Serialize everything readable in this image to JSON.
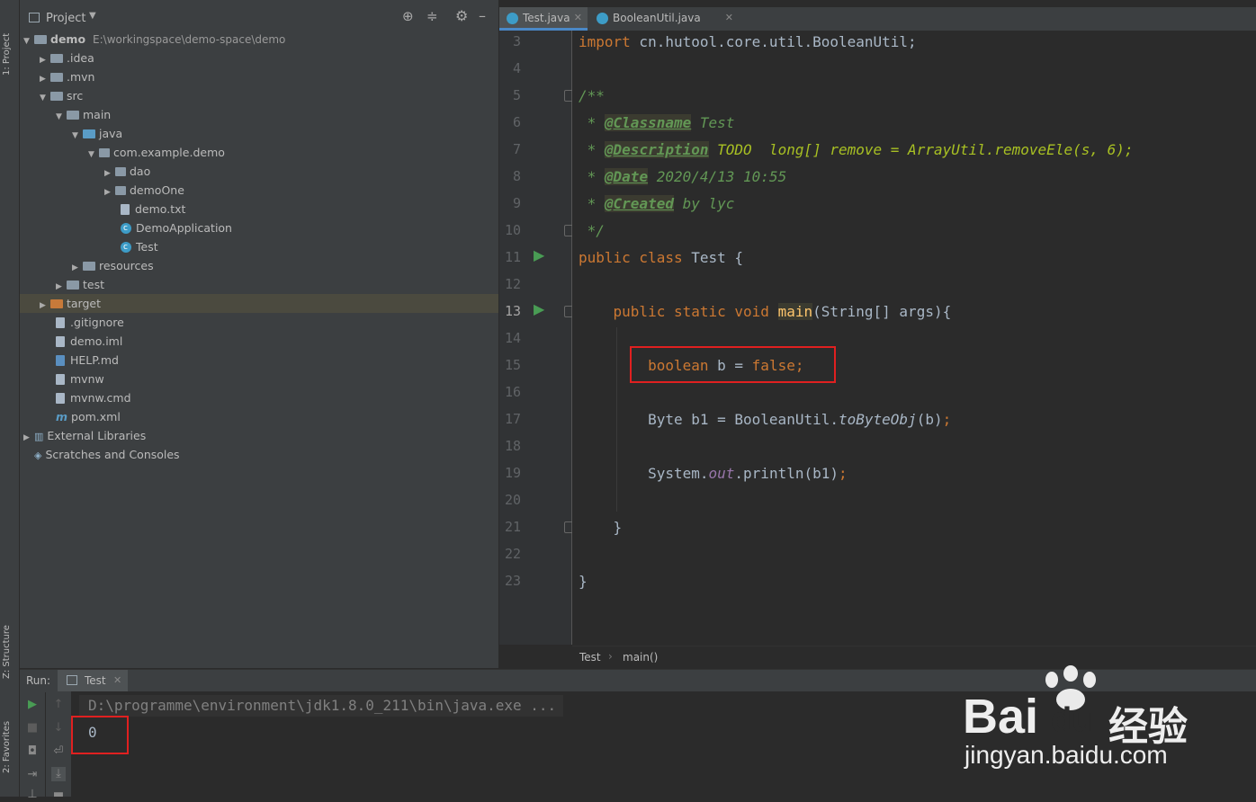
{
  "left_strip": {
    "project_label": "1: Project",
    "structure_label": "Z: Structure",
    "favorites_label": "2: Favorites"
  },
  "project_panel": {
    "title": "Project",
    "root_name": "demo",
    "root_path": "E:\\workingspace\\demo-space\\demo",
    "items": [
      {
        "label": ".idea"
      },
      {
        "label": ".mvn"
      },
      {
        "label": "src"
      },
      {
        "label": "main"
      },
      {
        "label": "java"
      },
      {
        "label": "com.example.demo"
      },
      {
        "label": "dao"
      },
      {
        "label": "demoOne"
      },
      {
        "label": "demo.txt"
      },
      {
        "label": "DemoApplication"
      },
      {
        "label": "Test"
      },
      {
        "label": "resources"
      },
      {
        "label": "test"
      },
      {
        "label": "target"
      },
      {
        "label": ".gitignore"
      },
      {
        "label": "demo.iml"
      },
      {
        "label": "HELP.md"
      },
      {
        "label": "mvnw"
      },
      {
        "label": "mvnw.cmd"
      },
      {
        "label": "pom.xml"
      },
      {
        "label": "External Libraries"
      },
      {
        "label": "Scratches and Consoles"
      }
    ]
  },
  "tabs": [
    {
      "label": "Test.java"
    },
    {
      "label": "BooleanUtil.java"
    }
  ],
  "line_numbers": [
    "3",
    "4",
    "5",
    "6",
    "7",
    "8",
    "9",
    "10",
    "11",
    "12",
    "13",
    "14",
    "15",
    "16",
    "17",
    "18",
    "19",
    "20",
    "21",
    "22",
    "23"
  ],
  "code": {
    "l3_import": "import",
    "l3_rest": " cn.hutool.core.util.BooleanUtil;",
    "l5": "/**",
    "l6_star": " * ",
    "l6_tag": "@Classname",
    "l6_rest": " Test",
    "l7_star": " * ",
    "l7_tag": "@Description",
    "l7_rest": " TODO  long[] remove = ArrayUtil.removeEle(s, 6);",
    "l8_star": " * ",
    "l8_tag": "@Date",
    "l8_rest": " 2020/4/13 10:55",
    "l9_star": " * ",
    "l9_tag": "@Created",
    "l9_rest": " by lyc",
    "l10": " */",
    "l11_kw": "public class",
    "l11_rest": " Test {",
    "l13_kw": "    public static void ",
    "l13_fn": "main",
    "l13_rest": "(String[] args){",
    "l15_kw1": "        boolean",
    "l15_mid": " b = ",
    "l15_kw2": "false;",
    "l17_a": "        Byte b1 = BooleanUtil.",
    "l17_b": "toByteObj",
    "l17_c": "(b)",
    "l17_d": ";",
    "l19_a": "        System.",
    "l19_b": "out",
    "l19_c": ".println(b1)",
    "l19_d": ";",
    "l21": "    }",
    "l23": "}"
  },
  "breadcrumb": {
    "class_name": "Test",
    "method_name": "main()"
  },
  "run": {
    "run_label": "Run:",
    "tab_label": "Test",
    "command": "D:\\programme\\environment\\jdk1.8.0_211\\bin\\java.exe ...",
    "output": "0"
  },
  "watermark": {
    "brand": "Bai",
    "brand2": "du",
    "cn": "经验",
    "url": "jingyan.baidu.com"
  },
  "colors": {
    "keyword": "#cc7832",
    "comment": "#629755",
    "highlight_box": "#e02020",
    "panel_bg": "#3c3f41",
    "editor_bg": "#2b2b2b"
  }
}
